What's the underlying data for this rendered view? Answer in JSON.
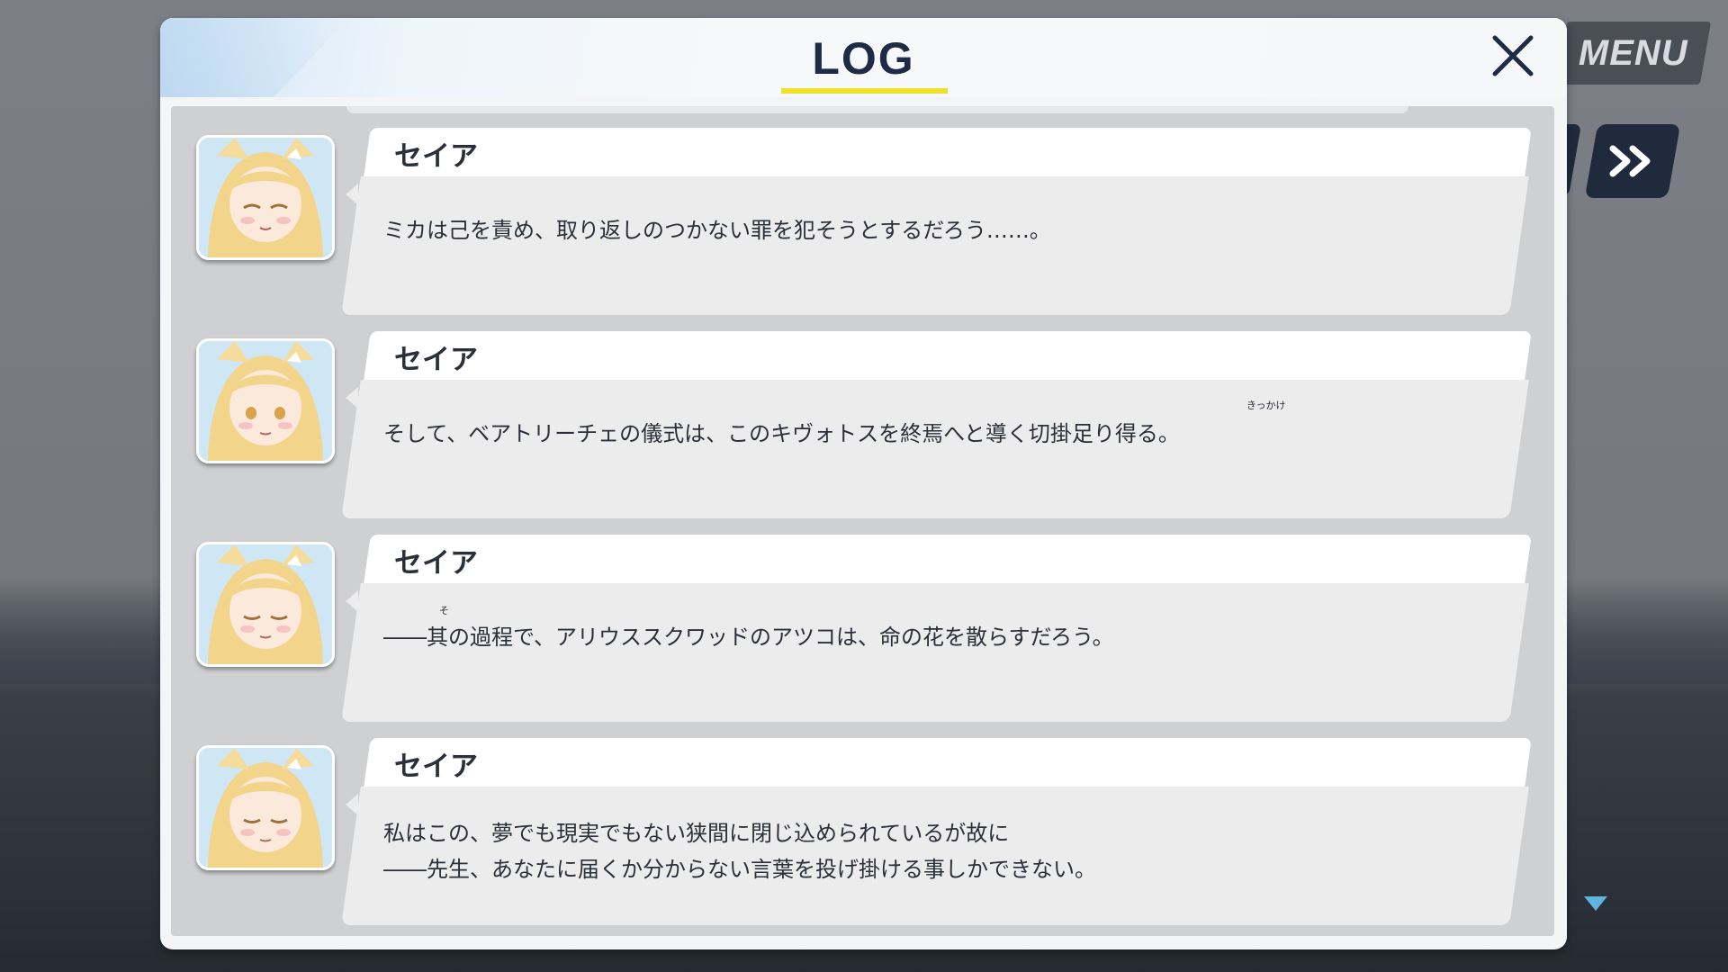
{
  "window": {
    "title": "LOG"
  },
  "menu": {
    "label": "MENU"
  },
  "icons": {
    "close": "close-icon",
    "fast_forward": "fast-forward-icon",
    "scroll_down": "chevron-down-icon"
  },
  "colors": {
    "title": "#1d2b46",
    "underline": "#f1e02a",
    "panel": "#cfd0d2",
    "bubble": "#ececed",
    "button_dark": "#1f2b3d"
  },
  "entries": [
    {
      "speaker": "セイア",
      "lines": [
        "ミカは己を責め、取り返しのつかない罪を犯そうとするだろう……。"
      ]
    },
    {
      "speaker": "セイア",
      "lines": [
        "そして、ベアトリーチェの儀式は、このキヴォトスを終焉へと導く切掛足り得る。"
      ],
      "ruby": "きっかけ"
    },
    {
      "speaker": "セイア",
      "lines": [
        "――其の過程で、アリウススクワッドのアツコは、命の花を散らすだろう。"
      ],
      "ruby": "そ"
    },
    {
      "speaker": "セイア",
      "lines": [
        "私はこの、夢でも現実でもない狭間に閉じ込められているが故に",
        "――先生、あなたに届くか分からない言葉を投げ掛ける事しかできない。"
      ]
    }
  ]
}
